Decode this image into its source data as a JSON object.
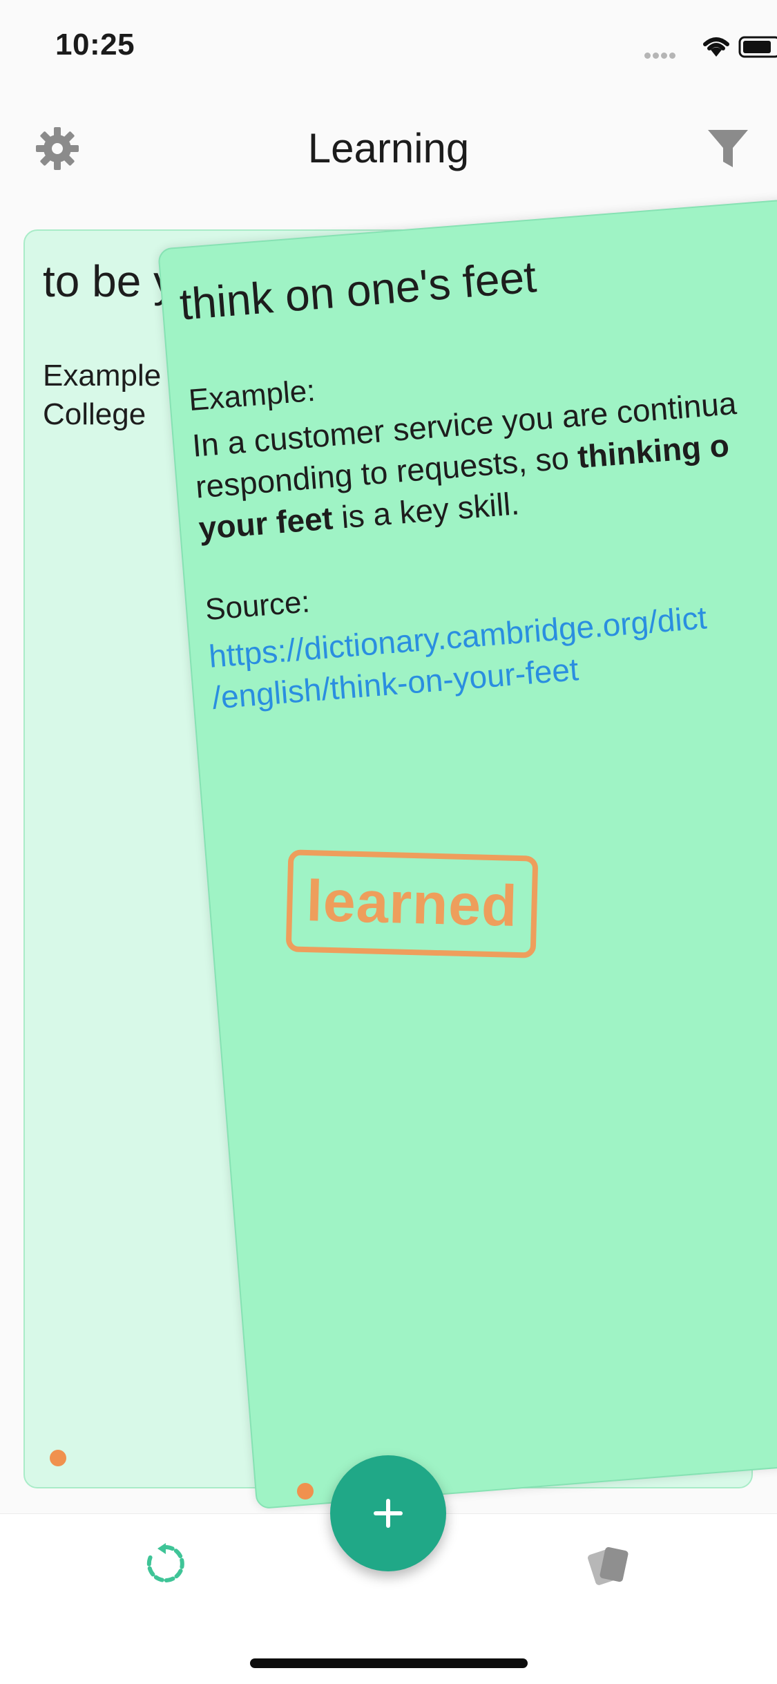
{
  "status_bar": {
    "time": "10:25",
    "wifi_icon": "wifi-icon",
    "battery_icon": "battery-icon"
  },
  "nav": {
    "title": "Learning",
    "settings_icon": "gear-icon",
    "filter_icon": "filter-icon"
  },
  "back_card": {
    "title": "to be yo",
    "text": "Example\nCollege"
  },
  "front_card": {
    "title": "think on one's feet",
    "example_label": "Example:",
    "example_text_before": "In a customer service you are continua",
    "example_text_mid": "responding to requests, so ",
    "example_bold_1": "thinking o",
    "example_bold_2": "your feet",
    "example_text_after": " is a key skill.",
    "source_label": "Source:",
    "source_link_line1": "https://dictionary.cambridge.org/dict",
    "source_link_line2": "/english/think-on-your-feet",
    "stamp_text": "learned"
  },
  "tab_bar": {
    "review_icon": "refresh-icon",
    "cards_icon": "cards-icon",
    "add_button_icon": "plus-icon"
  },
  "colors": {
    "front_card_bg": "#9ff3c5",
    "back_card_bg": "#d8f9e8",
    "stamp": "#ee9e5c",
    "fab": "#20a887",
    "link": "#2a8ee0",
    "dot": "#f0914e"
  }
}
